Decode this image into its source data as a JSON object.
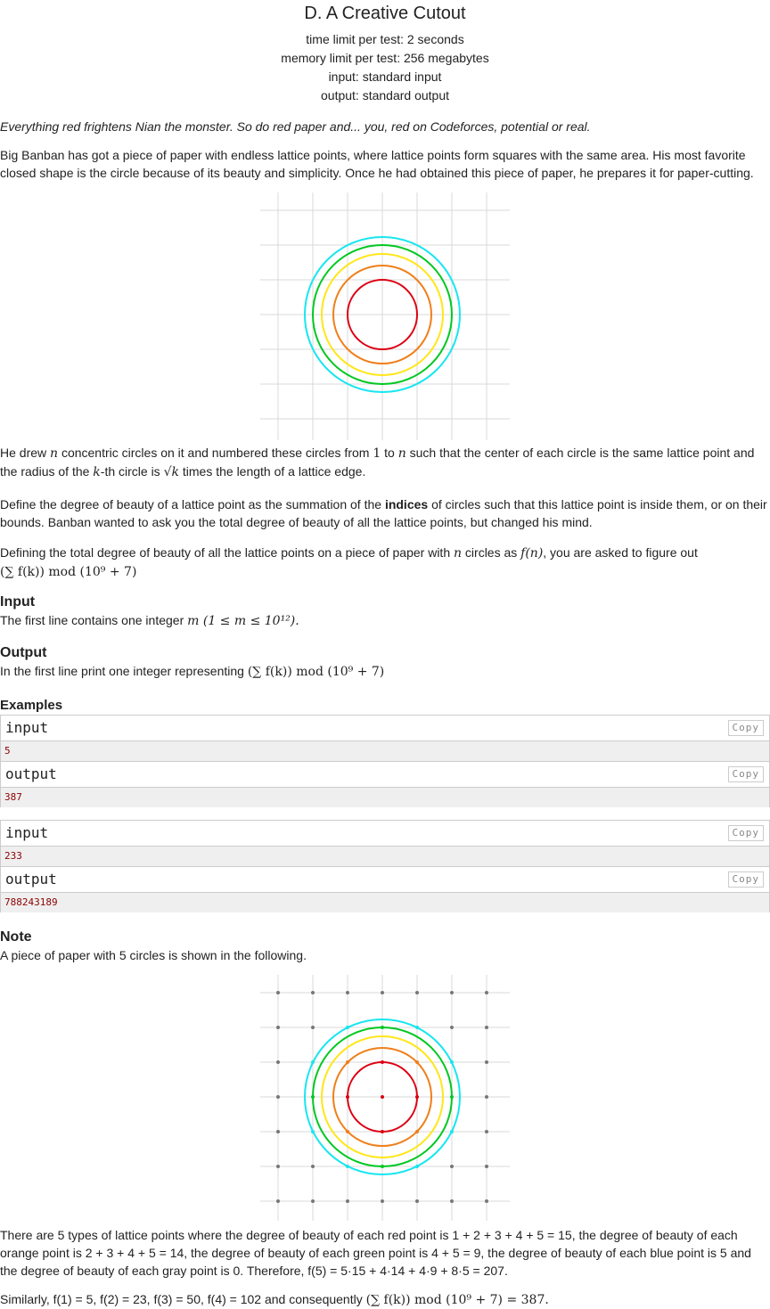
{
  "problem": {
    "title": "D. A Creative Cutout",
    "time_limit": "time limit per test: 2 seconds",
    "memory_limit": "memory limit per test: 256 megabytes",
    "input_file": "input: standard input",
    "output_file": "output: standard output"
  },
  "statement": {
    "legend": "Everything red frightens Nian the monster. So do red paper and... you, red on Codeforces, potential or real.",
    "p1": "Big Banban has got a piece of paper with endless lattice points, where lattice points form squares with the same area. His most favorite closed shape is the circle because of its beauty and simplicity. Once he had obtained this piece of paper, he prepares it for paper-cutting.",
    "p2_a": "He drew ",
    "p2_b": " concentric circles on it and numbered these circles from ",
    "p2_c": " to ",
    "p2_d": " such that the center of each circle is the same lattice point and the radius of the ",
    "p2_e": "-th circle is ",
    "p2_f": " times the length of a lattice edge.",
    "p3_a": "Define the degree of beauty of a lattice point as the summation of the ",
    "p3_bold": "indices",
    "p3_b": " of circles such that this lattice point is inside them, or on their bounds. Banban wanted to ask you the total degree of beauty of all the lattice points, but changed his mind.",
    "p4_a": "Defining the total degree of beauty of all the lattice points on a piece of paper with ",
    "p4_b": " circles as ",
    "p4_c": ", you are asked to figure out",
    "sym_n": "n",
    "sym_one": "1",
    "sym_k": "k",
    "sym_sqrtk": "√k",
    "sym_fn": "f(n)",
    "formula_sum": "(∑ f(k)) mod (10⁹ + 7)"
  },
  "input_spec": {
    "heading": "Input",
    "text": "The first line contains one integer ",
    "constraint": "m (1 ≤ m ≤ 10¹²)."
  },
  "output_spec": {
    "heading": "Output",
    "text": "In the first line print one integer representing "
  },
  "examples": {
    "heading": "Examples",
    "input_label": "input",
    "output_label": "output",
    "copy_label": "Copy",
    "tests": [
      {
        "input": "5",
        "output": "387"
      },
      {
        "input": "233",
        "output": "788243189"
      }
    ]
  },
  "note": {
    "heading": "Note",
    "intro": "A piece of paper with 5 circles is shown in the following.",
    "p1": "There are 5 types of lattice points where the degree of beauty of each red point is 1 + 2 + 3 + 4 + 5 = 15, the degree of beauty of each orange point is 2 + 3 + 4 + 5 = 14, the degree of beauty of each green point is 4 + 5 = 9, the degree of beauty of each blue point is 5 and the degree of beauty of each gray point is 0. Therefore, f(5) = 5·15 + 4·14 + 4·9 + 8·5 = 207.",
    "p2_a": "Similarly, f(1) = 5, f(2) = 23, f(3) = 50, f(4) = 102 and consequently ",
    "p2_b": "(∑ f(k)) mod (10⁹ + 7) = 387."
  },
  "colors": {
    "circle1": "#dd0011",
    "circle2": "#f07f1a",
    "circle3": "#ffe619",
    "circle4": "#00c821",
    "circle5": "#17e6f0",
    "grid": "#d8d8d8",
    "dot": "#777777"
  }
}
